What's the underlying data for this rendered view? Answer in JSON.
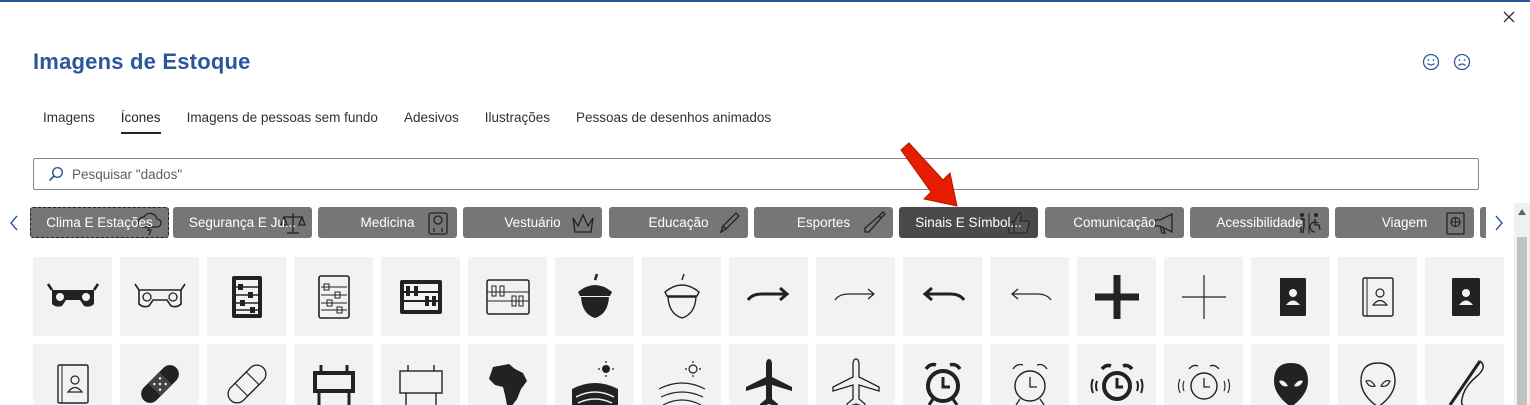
{
  "window": {
    "title": "Imagens de Estoque",
    "close_icon": "close-icon",
    "feedback_positive_icon": "smiley-happy-icon",
    "feedback_negative_icon": "smiley-sad-icon"
  },
  "tabs": [
    {
      "label": "Imagens",
      "active": false
    },
    {
      "label": "Ícones",
      "active": true
    },
    {
      "label": "Imagens de pessoas sem fundo",
      "active": false
    },
    {
      "label": "Adesivos",
      "active": false
    },
    {
      "label": "Ilustrações",
      "active": false
    },
    {
      "label": "Pessoas de desenhos animados",
      "active": false
    }
  ],
  "search": {
    "placeholder": "Pesquisar \"dados\"",
    "value": ""
  },
  "categories": [
    {
      "label": "Clima E Estações",
      "icon": "cloud-lightning-icon"
    },
    {
      "label": "Segurança E Ju...",
      "icon": "scales-icon"
    },
    {
      "label": "Medicina",
      "icon": "medical-scale-icon"
    },
    {
      "label": "Vestuário",
      "icon": "crown-icon"
    },
    {
      "label": "Educação",
      "icon": "pencil-icon"
    },
    {
      "label": "Esportes",
      "icon": "cricket-bat-icon"
    },
    {
      "label": "Sinais E Símbol...",
      "icon": "thumbs-up-icon",
      "active": true
    },
    {
      "label": "Comunicação",
      "icon": "megaphone-icon"
    },
    {
      "label": "Acessibilidade",
      "icon": "accessible-restroom-icon"
    },
    {
      "label": "Viagem",
      "icon": "passport-icon"
    }
  ],
  "icons_row1": [
    "3d-glasses-icon",
    "3d-glasses-outline-icon",
    "abacus-icon",
    "abacus-outline-icon",
    "abacus-wide-icon",
    "abacus-wide-outline-icon",
    "acorn-icon",
    "acorn-outline-icon",
    "arrow-curve-right-icon",
    "arrow-curve-right-outline-icon",
    "arrow-curve-left-icon",
    "arrow-curve-left-outline-icon",
    "plus-icon",
    "plus-outline-icon",
    "address-book-icon",
    "address-book-outline-icon",
    "address-book-dark-icon"
  ],
  "icons_row2": [
    "address-book-outline-icon",
    "bandage-icon",
    "bandage-outline-icon",
    "billboard-icon",
    "billboard-outline-icon",
    "africa-icon",
    "agriculture-icon",
    "agriculture-outline-icon",
    "airplane-icon",
    "airplane-outline-icon",
    "alarm-clock-icon",
    "alarm-clock-outline-icon",
    "alarm-ringing-icon",
    "alarm-ringing-outline-icon",
    "alien-icon",
    "alien-outline-icon",
    "needle-thread-icon"
  ],
  "colors": {
    "accent": "#2b579a",
    "category_bg": "#767676",
    "category_active_bg": "#4a4a4a",
    "tile_bg": "#f3f2f1",
    "annotation_arrow": "#e81c00"
  }
}
